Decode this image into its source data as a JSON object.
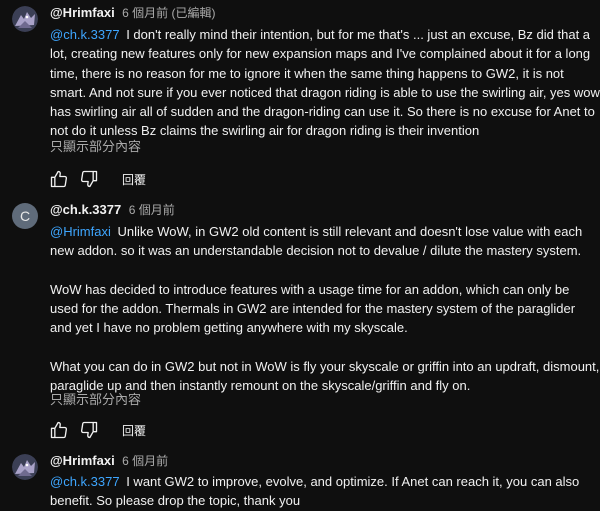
{
  "comments": [
    {
      "author": "@Hrimfaxi",
      "time": "6 個月前 (已編輯)",
      "avatar": "dragon-avatar",
      "mention": "@ch.k.3377",
      "text": "I don't really mind their intention, but for me that's ... just an excuse, Bz did that a lot, creating new features only for new expansion maps and I've complained about it for a long time, there is no reason for me to ignore it when the same thing happens to GW2, it is not smart. And not sure if you ever noticed that dragon riding is able to use the swirling air, yes wow has swirling air all of sudden and the dragon-riding can use it. So there is no excuse for Anet to not do it unless Bz claims the swirling air for dragon riding is their invention",
      "read_more": "只顯示部分內容",
      "reply_label": "回覆"
    },
    {
      "author": "@ch.k.3377",
      "time": "6 個月前",
      "avatar_letter": "C",
      "mention": "@Hrimfaxi",
      "text": "Unlike WoW, in GW2 old content is still relevant and doesn't lose value with each new addon. so it was an understandable decision not to devalue / dilute the mastery system.\n\nWoW has decided to introduce features with a usage time for an addon, which can only be used for the addon. Thermals in GW2 are intended for the mastery system of the paraglider and yet I have no problem getting anywhere with my skyscale.\n\nWhat you can do in GW2 but not in WoW is fly your skyscale or griffin into an updraft, dismount, paraglide up and then instantly remount on the skyscale/griffin and fly on.",
      "read_more": "只顯示部分內容",
      "reply_label": "回覆"
    },
    {
      "author": "@Hrimfaxi",
      "time": "6 個月前",
      "avatar": "dragon-avatar",
      "mention": "@ch.k.3377",
      "text": "I want GW2 to improve, evolve, and optimize. If Anet can reach it, you can also benefit. So please drop the topic, thank you"
    }
  ],
  "colors": {
    "background": "#0f0f0f",
    "text": "#f1f1f1",
    "secondary": "#aaaaaa",
    "link": "#3ea6ff",
    "avatar_letter_bg": "#5f6b7a"
  },
  "icons": {
    "like": "thumbs-up-icon",
    "dislike": "thumbs-down-icon"
  }
}
